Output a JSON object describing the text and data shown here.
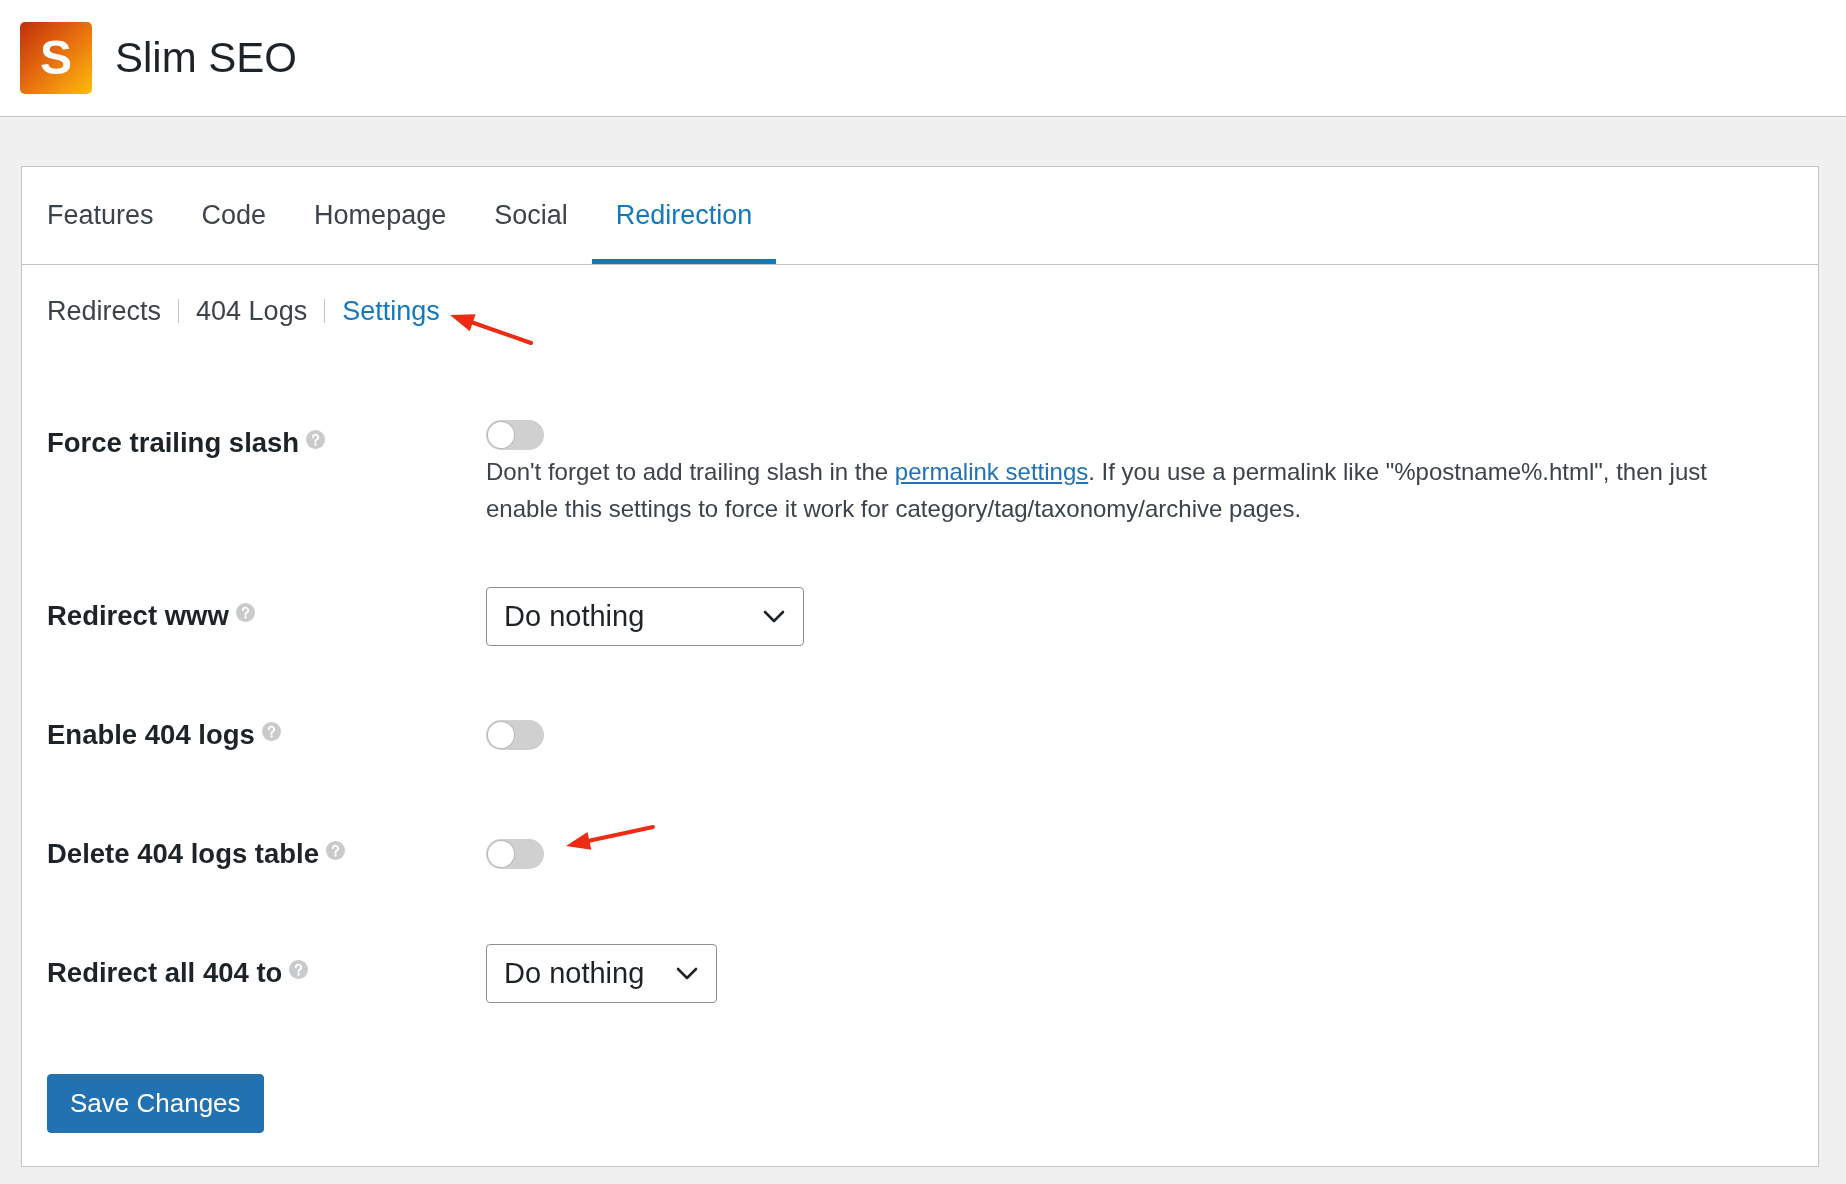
{
  "header": {
    "logo_letter": "S",
    "title": "Slim SEO"
  },
  "tabs": [
    {
      "label": "Features",
      "selected": false
    },
    {
      "label": "Code",
      "selected": false
    },
    {
      "label": "Homepage",
      "selected": false
    },
    {
      "label": "Social",
      "selected": false
    },
    {
      "label": "Redirection",
      "selected": true
    }
  ],
  "subnav": [
    {
      "label": "Redirects",
      "selected": false,
      "annotated": false
    },
    {
      "label": "404 Logs",
      "selected": false,
      "annotated": false
    },
    {
      "label": "Settings",
      "selected": true,
      "annotated": true
    }
  ],
  "settings": [
    {
      "kind": "toggle",
      "label": "Force trailing slash",
      "on": false,
      "annotated": false,
      "description": {
        "text_before": "Don't forget to add trailing slash in the ",
        "link": "permalink settings",
        "text_after": ". If you use a permalink like \"%postname%.html\", then just enable this settings to force it work for category/tag/taxonomy/archive pages."
      }
    },
    {
      "kind": "select",
      "label": "Redirect www",
      "value": "Do nothing",
      "annotated": false
    },
    {
      "kind": "toggle",
      "label": "Enable 404 logs",
      "on": false,
      "annotated": false
    },
    {
      "kind": "toggle",
      "label": "Delete 404 logs table",
      "on": false,
      "annotated": true
    },
    {
      "kind": "select",
      "label": "Redirect all 404 to",
      "value": "Do nothing",
      "annotated": false
    }
  ],
  "save_button": "Save Changes"
}
